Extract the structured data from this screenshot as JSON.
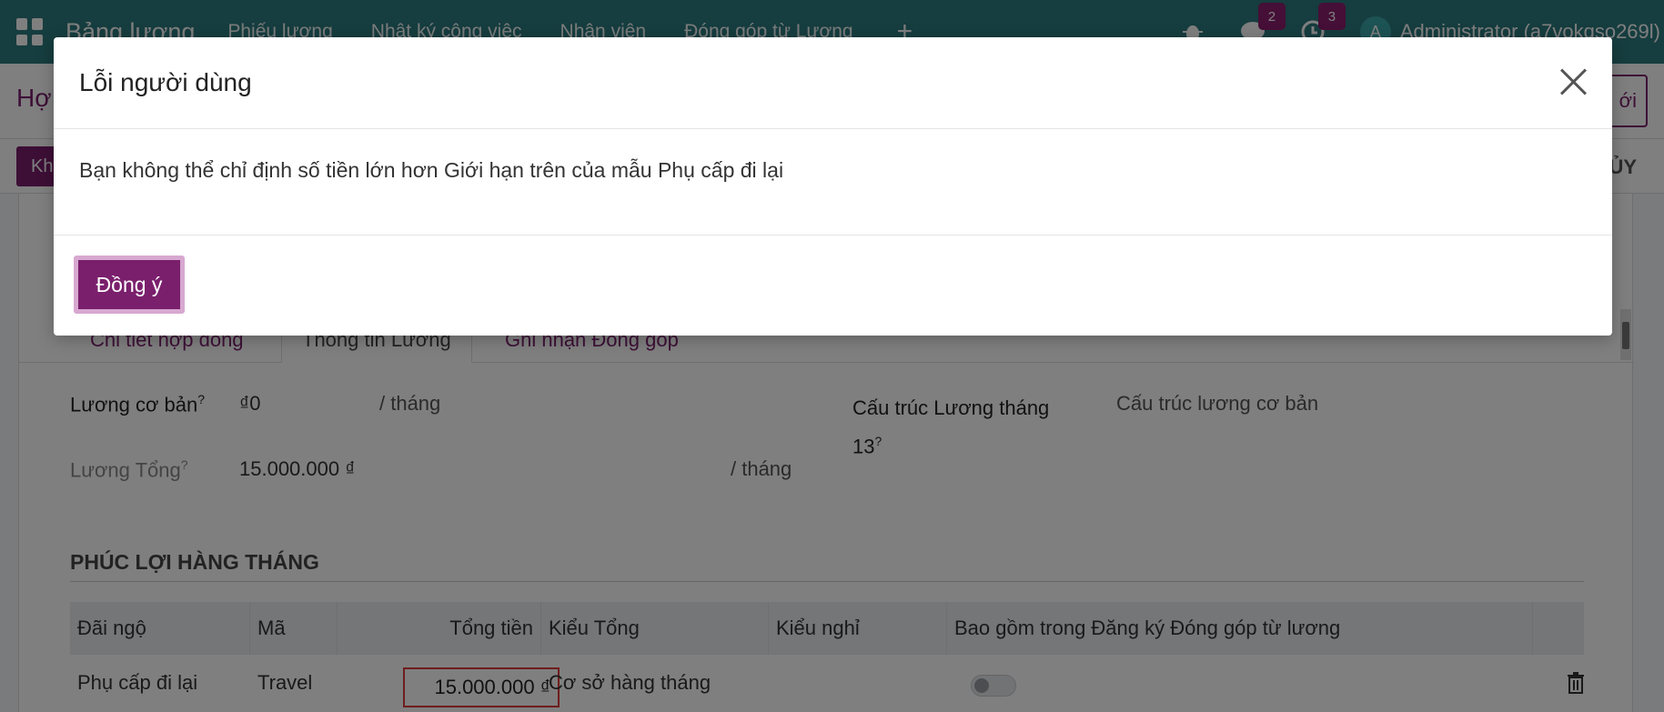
{
  "topnav": {
    "app_title": "Bảng lương",
    "menu": [
      "Phiếu lương",
      "Nhật ký công việc",
      "Nhân viên",
      "Đóng góp từ Lương"
    ],
    "plus": "+",
    "chat_badge": "2",
    "activity_badge": "3",
    "avatar_letter": "A",
    "user": "Administrator (a7vokqso269l)"
  },
  "subheader": {
    "breadcrumb": "Hợ",
    "new_label": "ới",
    "action_label": "Kh",
    "cancel_label": "ỦY"
  },
  "tabs": [
    {
      "label": "Chi tiết hợp đồng"
    },
    {
      "label": "Thông tin Lương"
    },
    {
      "label": "Ghi nhận Đóng góp"
    }
  ],
  "fields": {
    "basic_salary_label": "Lương cơ bản",
    "basic_salary_value": "₫0",
    "per_month": "/ tháng",
    "gross_label": "Lương Tổng",
    "gross_value": "15.000.000 ₫",
    "per_month2": "/ tháng",
    "struct13_label": "Cấu trúc Lương tháng 13",
    "struct13_value": "Cấu trúc lương cơ bản",
    "help_mark": "?"
  },
  "section": {
    "title": "PHÚC LỢI HÀNG THÁNG"
  },
  "table": {
    "headers": [
      "Đãi ngộ",
      "Mã",
      "Tổng tiền",
      "Kiểu Tổng",
      "Kiểu nghỉ",
      "Bao gồm trong Đăng ký Đóng góp từ lương"
    ],
    "row": {
      "benefit": "Phụ cấp đi lại",
      "code": "Travel",
      "amount": "15.000.000 ₫",
      "amount_type": "Cơ sở hàng tháng",
      "leave_type": ""
    }
  },
  "modal": {
    "title": "Lỗi người dùng",
    "message": "Bạn không thể chỉ định số tiền lớn hơn Giới hạn trên của mẫu Phụ cấp đi lại",
    "ok_label": "Đồng ý"
  },
  "colors": {
    "topnav": "#2c7a7f",
    "primary": "#7a1f6c",
    "highlight_border": "#e03a3a"
  }
}
